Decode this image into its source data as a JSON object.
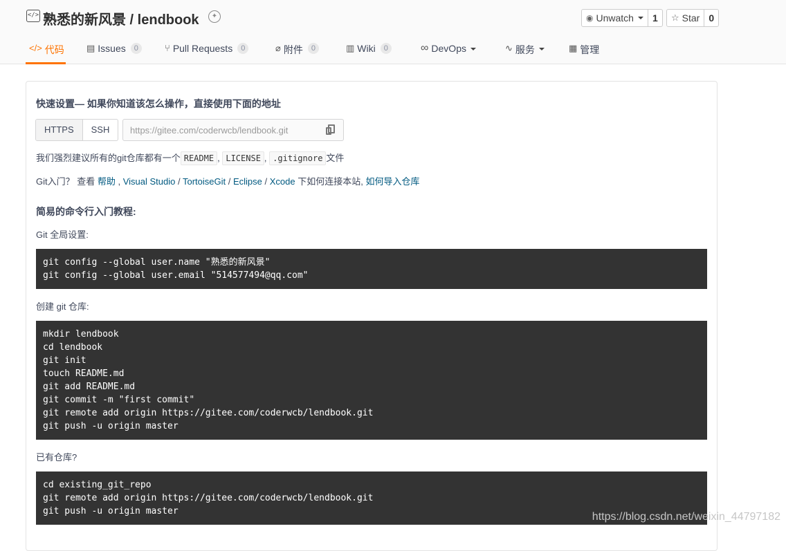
{
  "repo": {
    "title": "熟悉的新风景 / lendbook",
    "repo_icon": "code-file-icon",
    "badge_icon": "badge-icon"
  },
  "actions": {
    "watch": {
      "label": "Unwatch",
      "count": "1",
      "icon": "eye-icon"
    },
    "star": {
      "label": "Star",
      "count": "0",
      "icon": "star-icon"
    }
  },
  "tabs": [
    {
      "label": "代码",
      "icon": "code-icon",
      "count": null,
      "active": true
    },
    {
      "label": "Issues",
      "icon": "issues-icon",
      "count": "0"
    },
    {
      "label": "Pull Requests",
      "icon": "pull-request-icon",
      "count": "0"
    },
    {
      "label": "附件",
      "icon": "attachment-icon",
      "count": "0"
    },
    {
      "label": "Wiki",
      "icon": "wiki-icon",
      "count": "0"
    },
    {
      "label": "DevOps",
      "icon": "infinity-icon",
      "dropdown": true
    },
    {
      "label": "服务",
      "icon": "pulse-icon",
      "dropdown": true
    },
    {
      "label": "管理",
      "icon": "settings-doc-icon"
    }
  ],
  "setup": {
    "heading": "快速设置— 如果你知道该怎么操作，直接使用下面的地址",
    "protocols": [
      "HTTPS",
      "SSH"
    ],
    "url": "https://gitee.com/coderwcb/lendbook.git",
    "recommend_prefix": "我们强烈建议所有的git仓库都有一个",
    "files": [
      "README",
      "LICENSE",
      ".gitignore"
    ],
    "sep": ",",
    "recommend_suffix": "文件",
    "intro_prefix": "Git入门？ 查看 ",
    "intro_links": [
      "帮助",
      "Visual Studio",
      "TortoiseGit",
      "Eclipse",
      "Xcode"
    ],
    "intro_comma": " , ",
    "intro_slash": " / ",
    "intro_mid": " 下如何连接本站, ",
    "import_link": "如何导入仓库"
  },
  "cli": {
    "heading": "简易的命令行入门教程:",
    "global_label": "Git 全局设置:",
    "global_code": [
      "git config --global user.name \"熟悉的新风景\"",
      "git config --global user.email \"514577494@qq.com\""
    ],
    "create_label": "创建 git 仓库:",
    "create_code": [
      "mkdir lendbook",
      "cd lendbook",
      "git init",
      "touch README.md",
      "git add README.md",
      "git commit -m \"first commit\"",
      "git remote add origin https://gitee.com/coderwcb/lendbook.git",
      "git push -u origin master"
    ],
    "existing_label": "已有仓库?",
    "existing_code": [
      "cd existing_git_repo",
      "git remote add origin https://gitee.com/coderwcb/lendbook.git",
      "git push -u origin master"
    ]
  },
  "watermark": "https://blog.csdn.net/weixin_44797182"
}
